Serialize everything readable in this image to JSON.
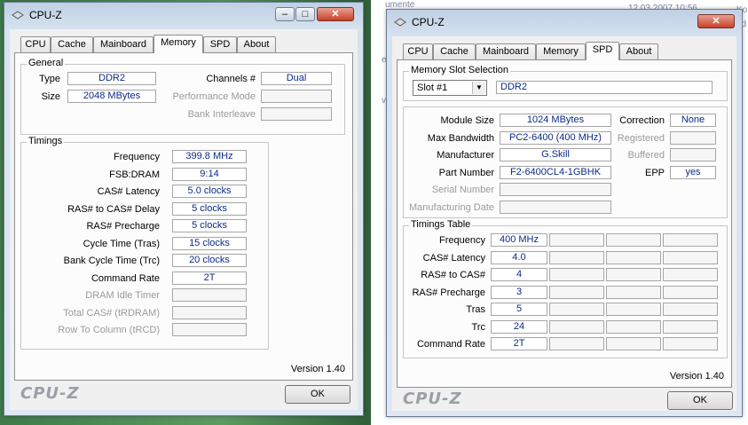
{
  "background": {
    "snippets": [
      "umente",
      "12.03.2007 10:56",
      "Ko",
      "nd",
      "et",
      "vi"
    ]
  },
  "left_window": {
    "title": "CPU-Z",
    "title_buttons": {
      "minimize": "–",
      "maximize": "□",
      "close": "✕"
    },
    "tabs": [
      "CPU",
      "Cache",
      "Mainboard",
      "Memory",
      "SPD",
      "About"
    ],
    "active_tab": "Memory",
    "general": {
      "title": "General",
      "type_label": "Type",
      "type_value": "DDR2",
      "size_label": "Size",
      "size_value": "2048 MBytes",
      "channels_label": "Channels #",
      "channels_value": "Dual",
      "perf_mode_label": "Performance Mode",
      "bank_interleave_label": "Bank Interleave"
    },
    "timings": {
      "title": "Timings",
      "rows": [
        {
          "label": "Frequency",
          "value": "399.8 MHz",
          "disabled": false
        },
        {
          "label": "FSB:DRAM",
          "value": "9:14",
          "disabled": false
        },
        {
          "label": "CAS# Latency",
          "value": "5.0 clocks",
          "disabled": false
        },
        {
          "label": "RAS# to CAS# Delay",
          "value": "5 clocks",
          "disabled": false
        },
        {
          "label": "RAS# Precharge",
          "value": "5 clocks",
          "disabled": false
        },
        {
          "label": "Cycle Time (Tras)",
          "value": "15 clocks",
          "disabled": false
        },
        {
          "label": "Bank Cycle Time (Trc)",
          "value": "20 clocks",
          "disabled": false
        },
        {
          "label": "Command Rate",
          "value": "2T",
          "disabled": false
        },
        {
          "label": "DRAM Idle Timer",
          "value": "",
          "disabled": true
        },
        {
          "label": "Total CAS# (tRDRAM)",
          "value": "",
          "disabled": true
        },
        {
          "label": "Row To Column (tRCD)",
          "value": "",
          "disabled": true
        }
      ]
    },
    "version": "Version 1.40",
    "brand": "CPU-Z",
    "ok_label": "OK"
  },
  "right_window": {
    "title": "CPU-Z",
    "title_buttons": {
      "close": "✕"
    },
    "tabs": [
      "CPU",
      "Cache",
      "Mainboard",
      "Memory",
      "SPD",
      "About"
    ],
    "active_tab": "SPD",
    "slot_selection": {
      "title": "Memory Slot Selection",
      "selected_slot": "Slot #1",
      "slot_type": "DDR2"
    },
    "module": {
      "module_size_label": "Module Size",
      "module_size_value": "1024 MBytes",
      "max_bandwidth_label": "Max Bandwidth",
      "max_bandwidth_value": "PC2-6400 (400 MHz)",
      "manufacturer_label": "Manufacturer",
      "manufacturer_value": "G.Skill",
      "part_number_label": "Part Number",
      "part_number_value": "F2-6400CL4-1GBHK",
      "serial_number_label": "Serial Number",
      "manufacturing_date_label": "Manufacturing Date",
      "correction_label": "Correction",
      "correction_value": "None",
      "registered_label": "Registered",
      "buffered_label": "Buffered",
      "epp_label": "EPP",
      "epp_value": "yes"
    },
    "timings_table": {
      "title": "Timings Table",
      "rows": [
        {
          "label": "Frequency",
          "value": "400 MHz"
        },
        {
          "label": "CAS# Latency",
          "value": "4.0"
        },
        {
          "label": "RAS# to CAS#",
          "value": "4"
        },
        {
          "label": "RAS# Precharge",
          "value": "3"
        },
        {
          "label": "Tras",
          "value": "5"
        },
        {
          "label": "Trc",
          "value": "24"
        },
        {
          "label": "Command Rate",
          "value": "2T"
        }
      ]
    },
    "version": "Version 1.40",
    "brand": "CPU-Z",
    "ok_label": "OK"
  }
}
